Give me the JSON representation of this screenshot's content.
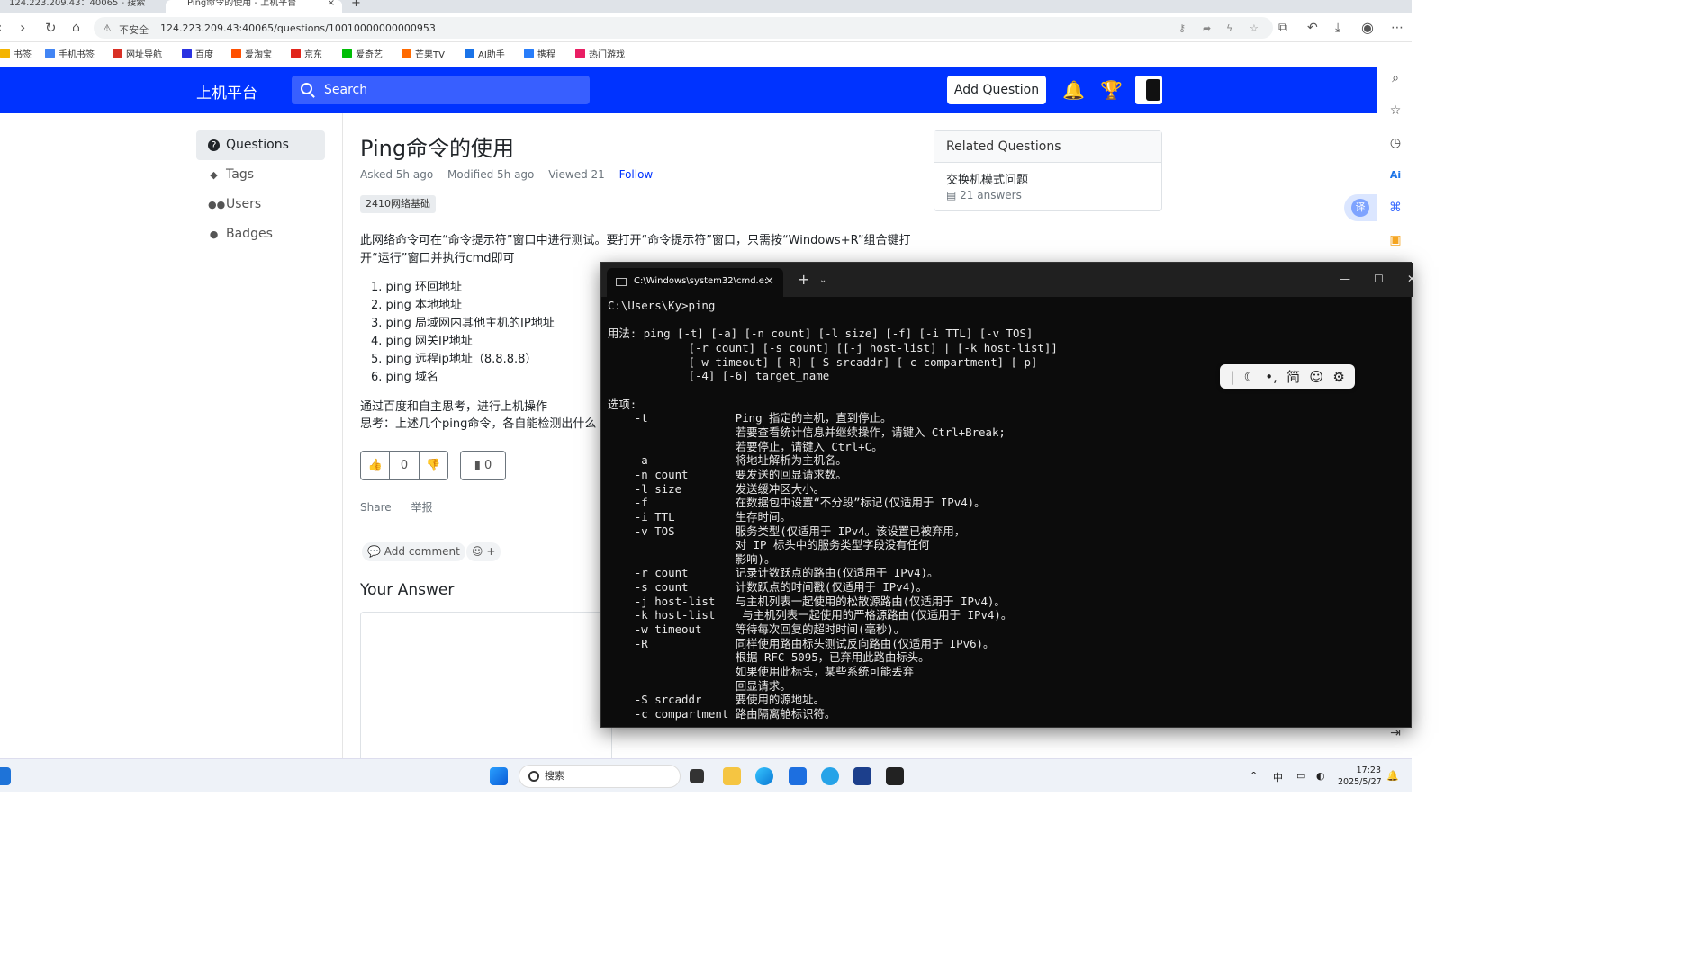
{
  "browser": {
    "tabs": [
      {
        "title": "124.223.209.43：40065 - 搜索"
      },
      {
        "title": "Ping命令的使用 - 上机平台"
      }
    ],
    "new_tab": "+",
    "security_label": "不安全",
    "url": "124.223.209.43:40065/questions/10010000000000953",
    "bookmarks": [
      {
        "label": "书签",
        "color": "#f4b400"
      },
      {
        "label": "手机书签",
        "color": "#4285f4"
      },
      {
        "label": "网址导航",
        "color": "#d93025"
      },
      {
        "label": "百度",
        "color": "#2932e1"
      },
      {
        "label": "爱淘宝",
        "color": "#ff5000"
      },
      {
        "label": "京东",
        "color": "#e1251b"
      },
      {
        "label": "爱奇艺",
        "color": "#00be06"
      },
      {
        "label": "芒果TV",
        "color": "#ff6a00"
      },
      {
        "label": "AI助手",
        "color": "#1a73e8"
      },
      {
        "label": "携程",
        "color": "#287dfa"
      },
      {
        "label": "热门游戏",
        "color": "#e91e63"
      }
    ]
  },
  "site": {
    "brand": "上机平台",
    "search_placeholder": "Search",
    "add_question": "Add Question",
    "header_color": "#0033ff"
  },
  "nav": [
    {
      "label": "Questions",
      "icon": "question-circle-icon",
      "glyph": "?"
    },
    {
      "label": "Tags",
      "icon": "tag-icon",
      "glyph": "◆"
    },
    {
      "label": "Users",
      "icon": "users-icon",
      "glyph": "👥"
    },
    {
      "label": "Badges",
      "icon": "badge-icon",
      "glyph": "●"
    }
  ],
  "question": {
    "title": "Ping命令的使用",
    "asked": "Asked 5h ago",
    "modified": "Modified 5h ago",
    "viewed": "Viewed 21",
    "follow": "Follow",
    "tag": "2410网络基础",
    "intro": "此网络命令可在“命令提示符”窗口中进行测试。要打开“命令提示符”窗口，只需按“Windows+R”组合键打开“运行”窗口并执行cmd即可",
    "list": [
      "ping 环回地址",
      "ping 本地地址",
      "ping 局域网内其他主机的IP地址",
      "ping 网关IP地址",
      "ping 远程ip地址（8.8.8.8）",
      "ping 域名"
    ],
    "para2": "通过百度和自主思考，进行上机操作",
    "para3": "思考：上述几个ping命令，各自能检测出什么",
    "votes": "0",
    "bookmarks": "0",
    "share": "Share",
    "report": "举报",
    "add_comment": "Add comment",
    "emoji_plus": "+",
    "your_answer": "Your Answer"
  },
  "related": {
    "heading": "Related Questions",
    "items": [
      {
        "title": "交换机模式问题",
        "answers": "21 answers"
      }
    ]
  },
  "translate_label": "译",
  "cmd": {
    "tab_title": "C:\\Windows\\system32\\cmd.e:",
    "lines": [
      "C:\\Users\\Ky>ping",
      "",
      "用法: ping [-t] [-a] [-n count] [-l size] [-f] [-i TTL] [-v TOS]",
      "            [-r count] [-s count] [[-j host-list] | [-k host-list]]",
      "            [-w timeout] [-R] [-S srcaddr] [-c compartment] [-p]",
      "            [-4] [-6] target_name",
      "",
      "选项:",
      "    -t             Ping 指定的主机，直到停止。",
      "                   若要查看统计信息并继续操作，请键入 Ctrl+Break;",
      "                   若要停止，请键入 Ctrl+C。",
      "    -a             将地址解析为主机名。",
      "    -n count       要发送的回显请求数。",
      "    -l size        发送缓冲区大小。",
      "    -f             在数据包中设置“不分段”标记(仅适用于 IPv4)。",
      "    -i TTL         生存时间。",
      "    -v TOS         服务类型(仅适用于 IPv4。该设置已被弃用，",
      "                   对 IP 标头中的服务类型字段没有任何",
      "                   影响)。",
      "    -r count       记录计数跃点的路由(仅适用于 IPv4)。",
      "    -s count       计数跃点的时间戳(仅适用于 IPv4)。",
      "    -j host-list   与主机列表一起使用的松散源路由(仅适用于 IPv4)。",
      "    -k host-list    与主机列表一起使用的严格源路由(仅适用于 IPv4)。",
      "    -w timeout     等待每次回复的超时时间(毫秒)。",
      "    -R             同样使用路由标头测试反向路由(仅适用于 IPv6)。",
      "                   根据 RFC 5095，已弃用此路由标头。",
      "                   如果使用此标头，某些系统可能丢弃",
      "                   回显请求。",
      "    -S srcaddr     要使用的源地址。",
      "    -c compartment 路由隔离舱标识符。"
    ]
  },
  "ime": {
    "simplified": "简"
  },
  "taskbar": {
    "search": "搜索",
    "ime_lang": "中",
    "time": "17:23",
    "date": "2025/5/27"
  }
}
